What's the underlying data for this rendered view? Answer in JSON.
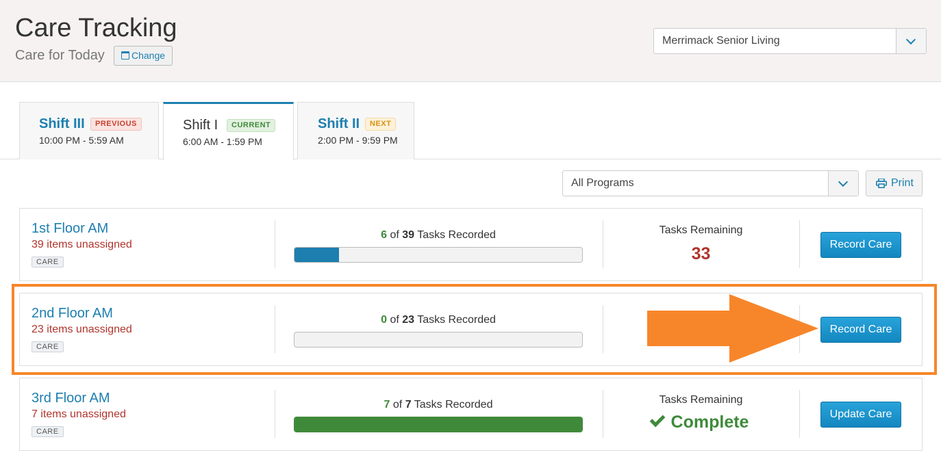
{
  "header": {
    "title": "Care Tracking",
    "subtitle": "Care for Today",
    "change_label": "Change",
    "facility_selected": "Merrimack Senior Living"
  },
  "tabs": [
    {
      "name": "Shift III",
      "badge": "PREVIOUS",
      "time": "10:00 PM - 5:59 AM",
      "active": false
    },
    {
      "name": "Shift I",
      "badge": "CURRENT",
      "time": "6:00 AM - 1:59 PM",
      "active": true
    },
    {
      "name": "Shift II",
      "badge": "NEXT",
      "time": "2:00 PM - 9:59 PM",
      "active": false
    }
  ],
  "toolbar": {
    "programs_selected": "All Programs",
    "print_label": "Print"
  },
  "cards": [
    {
      "title": "1st Floor AM",
      "unassigned": "39 items unassigned",
      "tag": "CARE",
      "done": "6",
      "of": "of",
      "total": "39",
      "tasks_suffix": "Tasks Recorded",
      "progress": 0.154,
      "remaining_label": "Tasks Remaining",
      "remaining_value": "33",
      "action_label": "Record Care"
    },
    {
      "title": "2nd Floor AM",
      "unassigned": "23 items unassigned",
      "tag": "CARE",
      "done": "0",
      "of": "of",
      "total": "23",
      "tasks_suffix": "Tasks Recorded",
      "progress": 0,
      "action_label": "Record Care"
    },
    {
      "title": "3rd Floor AM",
      "unassigned": "7 items unassigned",
      "tag": "CARE",
      "done": "7",
      "of": "of",
      "total": "7",
      "tasks_suffix": "Tasks Recorded",
      "progress": 1,
      "remaining_label": "Tasks Remaining",
      "remaining_value": "Complete",
      "action_label": "Update Care"
    }
  ],
  "colors": {
    "accent": "#1d7fb0",
    "danger": "#b0342c",
    "success": "#3f8a3a",
    "highlight": "#f7862a"
  }
}
